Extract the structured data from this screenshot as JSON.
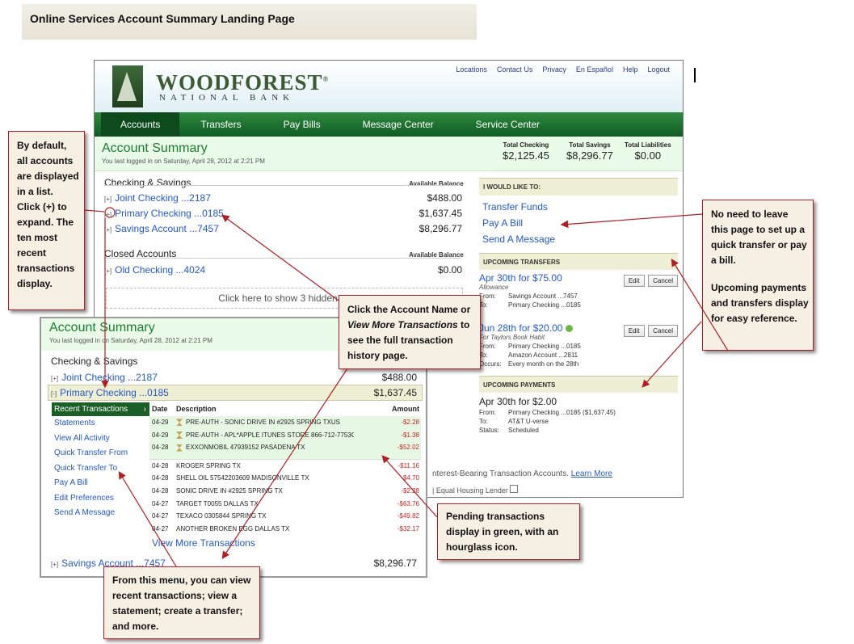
{
  "page_title": "Online Services Account Summary Landing Page",
  "bank": {
    "name": "WOODFOREST",
    "reg": "®",
    "sub": "NATIONAL BANK",
    "top_links": [
      "Locations",
      "Contact Us",
      "Privacy",
      "En Español",
      "Help",
      "Logout"
    ]
  },
  "nav": {
    "tabs": [
      "Accounts",
      "Transfers",
      "Pay Bills",
      "Message Center",
      "Service Center"
    ],
    "active": "Accounts"
  },
  "summary": {
    "title": "Account Summary",
    "last_login": "You last logged in on Saturday, April 28, 2012 at 2:21 PM",
    "totals": [
      {
        "label": "Total Checking",
        "value": "$2,125.45"
      },
      {
        "label": "Total Savings",
        "value": "$8,296.77"
      },
      {
        "label": "Total Liabilities",
        "value": "$0.00"
      }
    ]
  },
  "checking_savings": {
    "heading": "Checking & Savings",
    "balance_label": "Available Balance",
    "accounts": [
      {
        "toggle": "[+]",
        "name": "Joint Checking ...2187",
        "balance": "$488.00"
      },
      {
        "toggle": "[+]",
        "name": "Primary Checking ...0185",
        "balance": "$1,637.45"
      },
      {
        "toggle": "[+]",
        "name": "Savings Account ...7457",
        "balance": "$8,296.77"
      }
    ]
  },
  "closed_accounts": {
    "heading": "Closed Accounts",
    "balance_label": "Available Balance",
    "accounts": [
      {
        "toggle": "[+]",
        "name": "Old Checking ...4024",
        "balance": "$0.00"
      }
    ],
    "show_hidden": "Click here to show 3 hidden ac"
  },
  "footer_text": {
    "interest_prefix": "nterest-Bearing Transaction Accounts.",
    "learn_more": "Learn More",
    "equal_housing": "| Equal Housing Lender"
  },
  "right_panel": {
    "i_would_like": {
      "heading": "I WOULD LIKE TO:",
      "links": [
        "Transfer Funds",
        "Pay A Bill",
        "Send A Message"
      ]
    },
    "upcoming_transfers": {
      "heading": "UPCOMING TRANSFERS",
      "items": [
        {
          "title": "Apr 30th for $75.00",
          "note": "Allowance",
          "lines": [
            [
              "From:",
              "Savings Account ...7457"
            ],
            [
              "To:",
              "Primary Checking ...0185"
            ]
          ]
        },
        {
          "title": "Jun 28th for $20.00",
          "note": "For Taylors Book Habit",
          "lines": [
            [
              "From:",
              "Primary Checking ...0185"
            ],
            [
              "To:",
              "Amazon Account ...2811"
            ],
            [
              "Occurs:",
              "Every month on the 28th"
            ]
          ]
        }
      ],
      "edit": "Edit",
      "cancel": "Cancel"
    },
    "upcoming_payments": {
      "heading": "UPCOMING PAYMENTS",
      "title": "Apr 30th for $2.00",
      "lines": [
        [
          "From:",
          "Primary Checking ...0185 ($1,637.45)"
        ],
        [
          "To:",
          "AT&T U-verse"
        ],
        [
          "Status:",
          "Scheduled"
        ]
      ]
    }
  },
  "inset": {
    "title": "Account Summary",
    "last_login": "You last logged in on Saturday, April 28, 2012 at 2:21 PM",
    "heading": "Checking & Savings",
    "accounts": [
      {
        "toggle": "[+]",
        "name": "Joint Checking ...2187",
        "balance": "$488.00"
      },
      {
        "toggle": "[-]",
        "name": "Primary Checking ...0185",
        "balance": "$1,637.45"
      },
      {
        "toggle": "[+]",
        "name": "Savings Account ...7457",
        "balance": "$8,296.77"
      }
    ],
    "menu": [
      "Recent Transactions",
      "Statements",
      "View All Activity",
      "Quick Transfer From",
      "Quick Transfer To",
      "Pay A Bill",
      "Edit Preferences",
      "Send A Message"
    ],
    "columns": [
      "Date",
      "Description",
      "Amount"
    ],
    "pending": [
      {
        "date": "04-29",
        "desc": "PRE-AUTH - SONIC DRIVE IN #2925 SPRING TXUS",
        "amount": "-$2.28"
      },
      {
        "date": "04-29",
        "desc": "PRE-AUTH - APL*APPLE ITUNES STORE 866-712-7753C",
        "amount": "-$1.38"
      },
      {
        "date": "04-28",
        "desc": "EXXONMOBIL 47939152 PASADENA TX",
        "amount": "-$52.02"
      }
    ],
    "posted": [
      {
        "date": "04-28",
        "desc": "KROGER SPRING TX",
        "amount": "-$11.16"
      },
      {
        "date": "04-28",
        "desc": "SHELL OIL 57542203609 MADISONVILLE TX",
        "amount": "-$4.70"
      },
      {
        "date": "04-28",
        "desc": "SONIC DRIVE IN #2925 SPRING TX",
        "amount": "-$2.28"
      },
      {
        "date": "04-27",
        "desc": "TARGET T0055 DALLAS TX",
        "amount": "-$63.76"
      },
      {
        "date": "04-27",
        "desc": "TEXACO 0305844 SPRING TX",
        "amount": "-$49.82"
      },
      {
        "date": "04-27",
        "desc": "ANOTHER BROKEN EGG DALLAS TX",
        "amount": "-$32.17"
      }
    ],
    "view_more": "View More Transactions"
  },
  "callouts": {
    "default_list": [
      "By default,",
      "all accounts",
      "are displayed",
      "in a list.",
      "Click (+) to",
      "expand.  The",
      "ten most",
      "recent",
      "transactions",
      "display."
    ],
    "click_account": {
      "a": "Click the Account  Name or",
      "b_italic": "View More Transactions",
      "b_rest": " to",
      "c": "see the full transaction",
      "d": "history page."
    },
    "no_need": [
      "No need to leave",
      "this page to set up a",
      "quick transfer or pay",
      "a bill.",
      "",
      "Upcoming payments",
      "and transfers display",
      "for easy reference."
    ],
    "pending_info": [
      "Pending transactions",
      "display in green, with an",
      "hourglass icon."
    ],
    "menu_info": [
      "From this menu, you can view",
      "recent transactions;  view a",
      "statement; create a transfer;",
      "and more."
    ]
  }
}
